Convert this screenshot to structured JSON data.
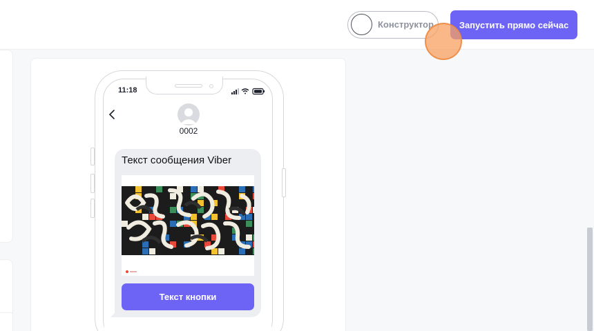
{
  "header": {
    "constructor_toggle": {
      "label": "Конструктор",
      "on": false
    },
    "launch_button": {
      "label": "Запустить прямо сейчас"
    }
  },
  "phone": {
    "status_bar": {
      "time": "11:18"
    },
    "contact": {
      "name": "0002"
    },
    "message": {
      "text": "Текст сообщения Viber",
      "button_label": "Текст кнопки"
    }
  },
  "colors": {
    "accent": "#6d63f4",
    "bubble": "#eceef1",
    "page_bg": "#f7f8fa"
  },
  "icons": [
    "back-chevron-icon",
    "avatar-icon",
    "signal-icon",
    "wifi-icon",
    "battery-icon"
  ]
}
